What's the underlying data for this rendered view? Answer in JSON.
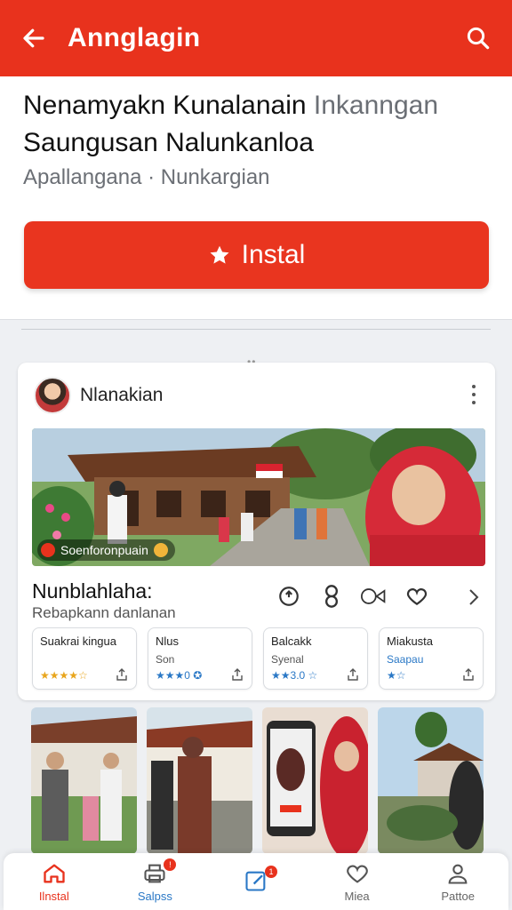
{
  "appbar": {
    "title": "Annglagin",
    "back_icon": "arrow-left-icon",
    "search_icon": "search-icon",
    "color": "#e8321d"
  },
  "info": {
    "headline_main": "Nenamyakn Kunalanain ",
    "headline_muted": "Inkanngan",
    "headline_line2": "Saungusan Nalunkanloa",
    "meta": "Apallangana · Nunkargian",
    "install_label": "Instal",
    "install_icon": "star-icon"
  },
  "card": {
    "author": "Nlanakian",
    "hero_caption": "Soenforonpuain",
    "section_title": "Nunblahlaha:",
    "section_subtitle": "Rebapkann danlanan",
    "minis": [
      {
        "title": "Suakrai kingua",
        "sub": "",
        "rating": "★★★★☆",
        "rating_style": "gold"
      },
      {
        "title": "Nlus",
        "sub": "Son",
        "rating": "★★★0 ✪",
        "rating_style": "blue"
      },
      {
        "title": "Balcakk",
        "sub": "Syenal",
        "rating": "★★3.0 ☆",
        "rating_style": "blue"
      },
      {
        "title": "Miakusta",
        "sub": "Saapau",
        "rating": "★☆",
        "rating_style": "blue"
      }
    ]
  },
  "bottomnav": {
    "items": [
      {
        "label": "Ilnstal",
        "icon": "home-icon",
        "active": true
      },
      {
        "label": "Salpss",
        "icon": "printer-icon",
        "badge": "!"
      },
      {
        "label": "",
        "icon": "edit-icon",
        "badge": "1"
      },
      {
        "label": "Miea",
        "icon": "heart-icon"
      },
      {
        "label": "Pattoe",
        "icon": "user-icon"
      }
    ]
  }
}
